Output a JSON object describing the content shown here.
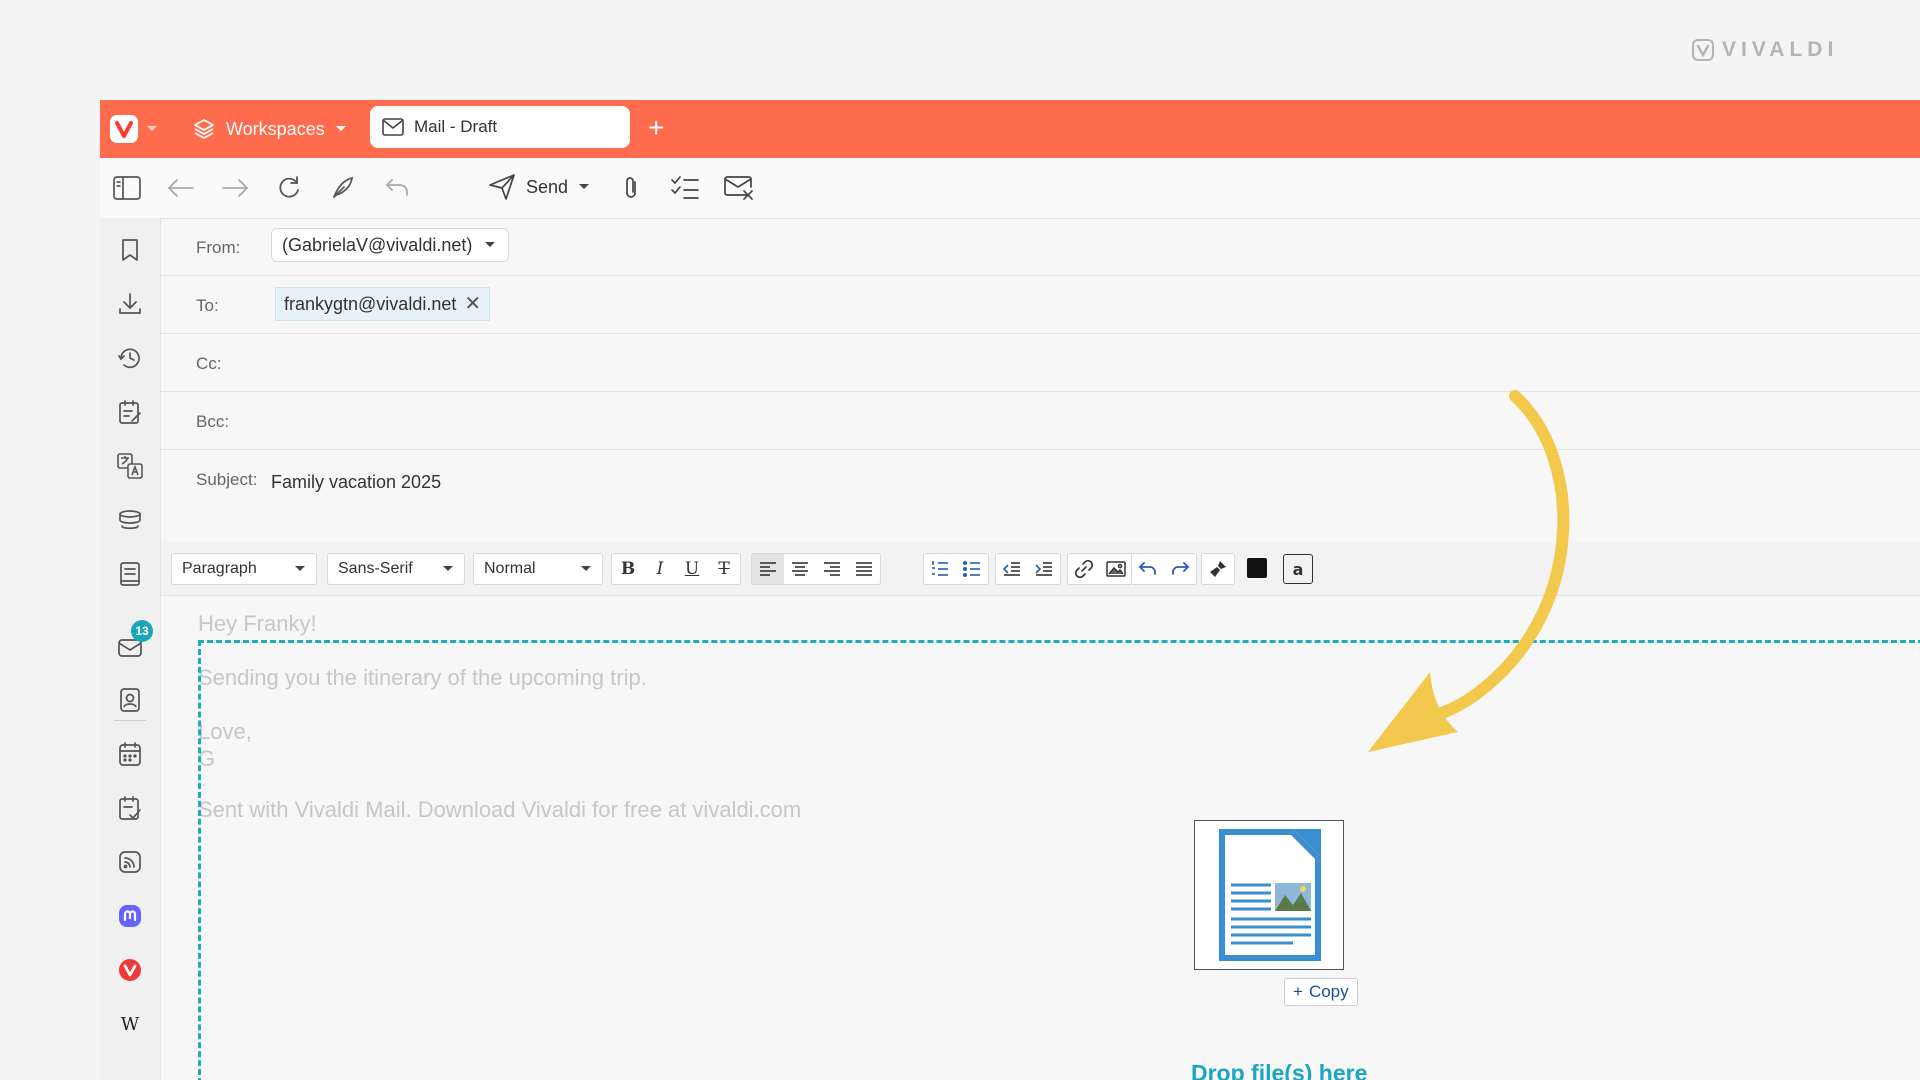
{
  "brand": {
    "name": "VIVALDI"
  },
  "tabbar": {
    "workspaces_label": "Workspaces",
    "active_tab_label": "Mail - Draft",
    "new_tab": "+"
  },
  "toolbar": {
    "send_label": "Send"
  },
  "sidepanel": {
    "mail_badge": "13"
  },
  "compose": {
    "from_label": "From:",
    "from_value": "(GabrielaV@vivaldi.net)",
    "to_label": "To:",
    "to_recipient": "frankygtn@vivaldi.net",
    "cc_label": "Cc:",
    "bcc_label": "Bcc:",
    "subject_label": "Subject:",
    "subject_value": "Family vacation 2025"
  },
  "format": {
    "block": "Paragraph",
    "font": "Sans-Serif",
    "size": "Normal"
  },
  "body": {
    "greeting": "Hey Franky!",
    "line1": "Sending you the itinerary of the upcoming trip.",
    "closing": "Love,",
    "sig_initial": "G",
    "sig_sep": "--",
    "footer": "Sent with Vivaldi Mail. Download Vivaldi for free at vivaldi.com"
  },
  "drop": {
    "copy_label": "Copy",
    "drop_text": "Drop file(s) here"
  },
  "colors": {
    "accent": "#ff6b4d",
    "drop_accent": "#1cabc0",
    "arrow": "#f2c94c"
  }
}
